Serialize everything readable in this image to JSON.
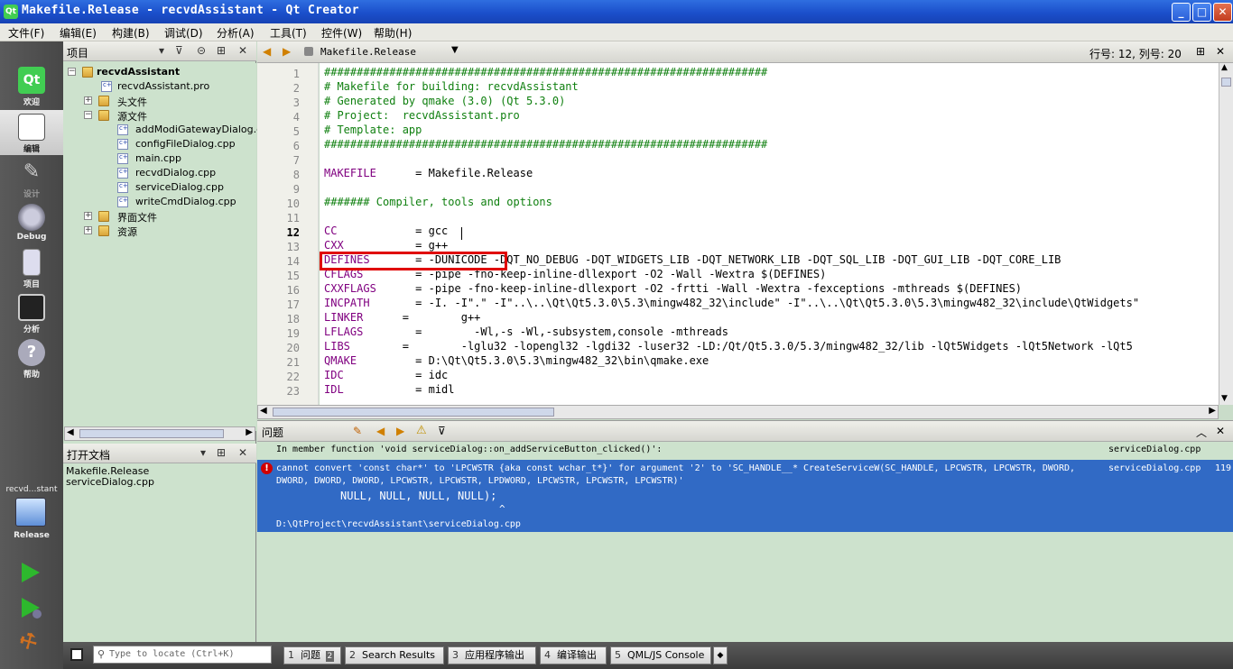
{
  "window": {
    "title": "Makefile.Release - recvdAssistant - Qt Creator",
    "min": "_",
    "max": "□",
    "close": "✕"
  },
  "menu": [
    "文件(F)",
    "编辑(E)",
    "构建(B)",
    "调试(D)",
    "分析(A)",
    "工具(T)",
    "控件(W)",
    "帮助(H)"
  ],
  "modes": [
    {
      "label": "欢迎",
      "icon": "qt-logo-icon"
    },
    {
      "label": "编辑",
      "icon": "edit-document-icon"
    },
    {
      "label": "设计",
      "icon": "design-icon"
    },
    {
      "label": "Debug",
      "icon": "debug-icon"
    },
    {
      "label": "项目",
      "icon": "project-icon"
    },
    {
      "label": "分析",
      "icon": "analyze-icon"
    },
    {
      "label": "帮助",
      "icon": "help-icon"
    }
  ],
  "target": {
    "project": "recvd…stant",
    "config": "Release"
  },
  "project_pane": {
    "title": "项目",
    "tree": [
      {
        "label": "recvdAssistant",
        "level": 0,
        "type": "project"
      },
      {
        "label": "recvdAssistant.pro",
        "level": 1,
        "type": "pro"
      },
      {
        "label": "头文件",
        "level": 1,
        "type": "folder",
        "collapsed": true
      },
      {
        "label": "源文件",
        "level": 1,
        "type": "folder",
        "collapsed": false
      },
      {
        "label": "addModiGatewayDialog.cpp",
        "level": 2,
        "type": "cpp"
      },
      {
        "label": "configFileDialog.cpp",
        "level": 2,
        "type": "cpp"
      },
      {
        "label": "main.cpp",
        "level": 2,
        "type": "cpp"
      },
      {
        "label": "recvdDialog.cpp",
        "level": 2,
        "type": "cpp"
      },
      {
        "label": "serviceDialog.cpp",
        "level": 2,
        "type": "cpp"
      },
      {
        "label": "writeCmdDialog.cpp",
        "level": 2,
        "type": "cpp"
      },
      {
        "label": "界面文件",
        "level": 1,
        "type": "folder",
        "collapsed": true
      },
      {
        "label": "资源",
        "level": 1,
        "type": "folder",
        "collapsed": true
      }
    ]
  },
  "open_docs": {
    "title": "打开文档",
    "items": [
      "Makefile.Release",
      "serviceDialog.cpp"
    ]
  },
  "editor": {
    "file": "Makefile.Release",
    "position": "行号: 12, 列号: 20",
    "lines": [
      {
        "n": "1",
        "t": "####################################################################",
        "c": "cm"
      },
      {
        "n": "2",
        "t": "# Makefile for building: recvdAssistant",
        "c": "cm"
      },
      {
        "n": "3",
        "t": "# Generated by qmake (3.0) (Qt 5.3.0)",
        "c": "cm"
      },
      {
        "n": "4",
        "t": "# Project:  recvdAssistant.pro",
        "c": "cm"
      },
      {
        "n": "5",
        "t": "# Template: app",
        "c": "cm"
      },
      {
        "n": "6",
        "t": "####################################################################",
        "c": "cm"
      },
      {
        "n": "7",
        "t": "",
        "c": "kw"
      },
      {
        "n": "8",
        "v": "MAKEFILE",
        "t": "      = Makefile.Release",
        "c": "vr"
      },
      {
        "n": "9",
        "t": "",
        "c": "kw"
      },
      {
        "n": "10",
        "t": "####### Compiler, tools and options",
        "c": "cm"
      },
      {
        "n": "11",
        "t": "",
        "c": "kw"
      },
      {
        "n": "12",
        "v": "CC",
        "t": "            = gcc",
        "c": "vr"
      },
      {
        "n": "13",
        "v": "CXX",
        "t": "           = g++",
        "c": "vr"
      },
      {
        "n": "14",
        "v": "DEFINES",
        "t": "       = -DUNICODE -DQT_NO_DEBUG -DQT_WIDGETS_LIB -DQT_NETWORK_LIB -DQT_SQL_LIB -DQT_GUI_LIB -DQT_CORE_LIB",
        "c": "vr"
      },
      {
        "n": "15",
        "v": "CFLAGS",
        "t": "        = -pipe -fno-keep-inline-dllexport -O2 -Wall -Wextra $(DEFINES)",
        "c": "vr"
      },
      {
        "n": "16",
        "v": "CXXFLAGS",
        "t": "      = -pipe -fno-keep-inline-dllexport -O2 -frtti -Wall -Wextra -fexceptions -mthreads $(DEFINES)",
        "c": "vr"
      },
      {
        "n": "17",
        "v": "INCPATH",
        "t": "       = -I. -I\".\" -I\"..\\..\\Qt\\Qt5.3.0\\5.3\\mingw482_32\\include\" -I\"..\\..\\Qt\\Qt5.3.0\\5.3\\mingw482_32\\include\\QtWidgets\"",
        "c": "vr"
      },
      {
        "n": "18",
        "v": "LINKER",
        "t": "      =        g++",
        "c": "vr"
      },
      {
        "n": "19",
        "v": "LFLAGS",
        "t": "        =        -Wl,-s -Wl,-subsystem,console -mthreads",
        "c": "vr"
      },
      {
        "n": "20",
        "v": "LIBS",
        "t": "        =        -lglu32 -lopengl32 -lgdi32 -luser32 -LD:/Qt/Qt5.3.0/5.3/mingw482_32/lib -lQt5Widgets -lQt5Network -lQt5",
        "c": "vr"
      },
      {
        "n": "21",
        "v": "QMAKE",
        "t": "         = D:\\Qt\\Qt5.3.0\\5.3\\mingw482_32\\bin\\qmake.exe",
        "c": "vr"
      },
      {
        "n": "22",
        "v": "IDC",
        "t": "           = idc",
        "c": "vr"
      },
      {
        "n": "23",
        "v": "IDL",
        "t": "           = midl",
        "c": "vr"
      }
    ]
  },
  "issues": {
    "title": "问题",
    "context": "In member function 'void serviceDialog::on_addServiceButton_clicked()':",
    "context_file": "serviceDialog.cpp",
    "error_line1": "cannot convert 'const char*' to 'LPCWSTR {aka const wchar_t*}' for argument '2' to 'SC_HANDLE__* CreateServiceW(SC_HANDLE, LPCWSTR, LPCWSTR, DWORD,",
    "error_line2": "DWORD, DWORD, DWORD, LPCWSTR, LPCWSTR, LPDWORD, LPCWSTR, LPCWSTR, LPCWSTR)'",
    "error_line3": "NULL, NULL, NULL, NULL);",
    "error_caret": "^",
    "error_path": "D:\\QtProject\\recvdAssistant\\serviceDialog.cpp",
    "error_file": "serviceDialog.cpp",
    "error_lineno": "119"
  },
  "statusbar": {
    "locate_placeholder": "Type to locate (Ctrl+K)",
    "buttons": [
      {
        "n": "1",
        "label": "问题",
        "badge": "2"
      },
      {
        "n": "2",
        "label": "Search Results"
      },
      {
        "n": "3",
        "label": "应用程序输出"
      },
      {
        "n": "4",
        "label": "编译输出"
      },
      {
        "n": "5",
        "label": "QML/JS Console"
      }
    ]
  },
  "colors": {
    "accent": "#316ac5",
    "error": "#d10000",
    "highlight": "#e00000"
  }
}
